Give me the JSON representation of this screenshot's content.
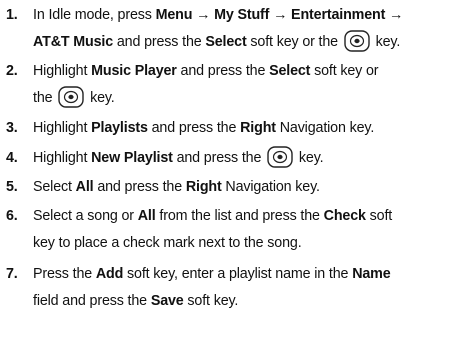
{
  "steps": [
    {
      "num": "1.",
      "p1": "In Idle mode, press ",
      "b1": "Menu → My Stuff → Entertainment →",
      "b2": "AT&T Music",
      "p2": " and press the ",
      "b3": "Select",
      "p3": " soft key or the ",
      "p4": " key."
    },
    {
      "num": "2.",
      "p1": "Highlight ",
      "b1": "Music Player",
      "p2": " and press the ",
      "b2": "Select",
      "p3": " soft key or",
      "p4": "the ",
      "p5": " key."
    },
    {
      "num": "3.",
      "p1": "Highlight ",
      "b1": "Playlists",
      "p2": " and press the ",
      "b2": "Right",
      "p3": " Navigation key."
    },
    {
      "num": "4.",
      "p1": "Highlight ",
      "b1": "New Playlist",
      "p2": " and press the ",
      "p3": " key."
    },
    {
      "num": "5.",
      "p1": "Select ",
      "b1": "All",
      "p2": " and press the ",
      "b2": "Right",
      "p3": " Navigation key."
    },
    {
      "num": "6.",
      "p1": "Select a song or ",
      "b1": "All",
      "p2": " from the list and press the ",
      "b2": "Check",
      "p3": " soft",
      "p4": "key to place a check mark next to the song."
    },
    {
      "num": "7.",
      "p1": "Press the ",
      "b1": "Add",
      "p2": " soft key, enter a playlist name in the ",
      "b2": "Name",
      "p3": "field and press the ",
      "b3": "Save",
      "p4": " soft key."
    }
  ],
  "icons": {
    "select_key": "select-key-icon"
  }
}
